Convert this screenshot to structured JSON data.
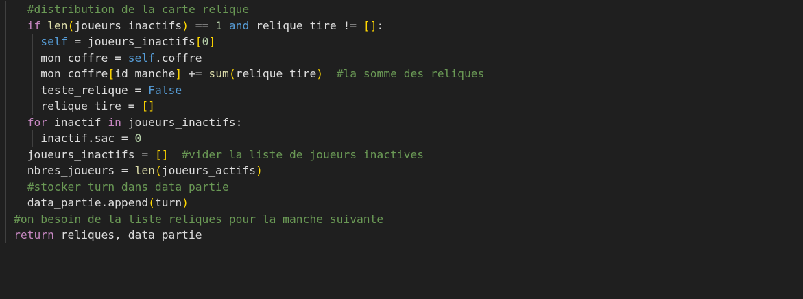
{
  "editor": {
    "language": "python",
    "theme_colors": {
      "background": "#1f1f1f",
      "keyword": "#c586c0",
      "function": "#dcdcaa",
      "comment": "#6a9955",
      "self": "#569cd6",
      "number": "#b5cea8",
      "bracket_level1": "#ffd700",
      "bracket_level2": "#da70d6",
      "bracket_level3": "#179fff"
    },
    "lines": [
      {
        "indent": 2,
        "tokens": [
          {
            "t": "#distribution de la carte relique",
            "c": "cm"
          }
        ]
      },
      {
        "indent": 2,
        "tokens": [
          {
            "t": "if",
            "c": "kw"
          },
          {
            "t": " ",
            "c": "id"
          },
          {
            "t": "len",
            "c": "fn"
          },
          {
            "t": "(",
            "c": "p1"
          },
          {
            "t": "joueurs_inactifs",
            "c": "id"
          },
          {
            "t": ")",
            "c": "p1"
          },
          {
            "t": " == ",
            "c": "op"
          },
          {
            "t": "1",
            "c": "num"
          },
          {
            "t": " ",
            "c": "id"
          },
          {
            "t": "and",
            "c": "and"
          },
          {
            "t": " relique_tire != ",
            "c": "id"
          },
          {
            "t": "[]",
            "c": "p1"
          },
          {
            "t": ":",
            "c": "id"
          }
        ]
      },
      {
        "indent": 3,
        "tokens": [
          {
            "t": "self",
            "c": "self"
          },
          {
            "t": " = joueurs_inactifs",
            "c": "id"
          },
          {
            "t": "[",
            "c": "p1"
          },
          {
            "t": "0",
            "c": "num"
          },
          {
            "t": "]",
            "c": "p1"
          }
        ]
      },
      {
        "indent": 3,
        "tokens": [
          {
            "t": "mon_coffre = ",
            "c": "id"
          },
          {
            "t": "self",
            "c": "self"
          },
          {
            "t": ".coffre",
            "c": "id"
          }
        ]
      },
      {
        "indent": 3,
        "tokens": [
          {
            "t": "mon_coffre",
            "c": "id"
          },
          {
            "t": "[",
            "c": "p1"
          },
          {
            "t": "id_manche",
            "c": "id"
          },
          {
            "t": "]",
            "c": "p1"
          },
          {
            "t": " += ",
            "c": "op"
          },
          {
            "t": "sum",
            "c": "fn"
          },
          {
            "t": "(",
            "c": "p1"
          },
          {
            "t": "relique_tire",
            "c": "id"
          },
          {
            "t": ")",
            "c": "p1"
          },
          {
            "t": "  ",
            "c": "id"
          },
          {
            "t": "#la somme des reliques",
            "c": "cm"
          }
        ]
      },
      {
        "indent": 3,
        "tokens": [
          {
            "t": "teste_relique = ",
            "c": "id"
          },
          {
            "t": "False",
            "c": "bool"
          }
        ]
      },
      {
        "indent": 3,
        "tokens": [
          {
            "t": "relique_tire = ",
            "c": "id"
          },
          {
            "t": "[]",
            "c": "p1"
          }
        ]
      },
      {
        "indent": 2,
        "tokens": [
          {
            "t": "for",
            "c": "kw"
          },
          {
            "t": " inactif ",
            "c": "id"
          },
          {
            "t": "in",
            "c": "kw"
          },
          {
            "t": " joueurs_inactifs:",
            "c": "id"
          }
        ]
      },
      {
        "indent": 3,
        "tokens": [
          {
            "t": "inactif.sac = ",
            "c": "id"
          },
          {
            "t": "0",
            "c": "num"
          }
        ]
      },
      {
        "indent": 2,
        "tokens": [
          {
            "t": "joueurs_inactifs = ",
            "c": "id"
          },
          {
            "t": "[]",
            "c": "p1"
          },
          {
            "t": "  ",
            "c": "id"
          },
          {
            "t": "#vider la liste de joueurs inactives",
            "c": "cm"
          }
        ]
      },
      {
        "indent": 2,
        "tokens": [
          {
            "t": "nbres_joueurs = ",
            "c": "id"
          },
          {
            "t": "len",
            "c": "fn"
          },
          {
            "t": "(",
            "c": "p1"
          },
          {
            "t": "joueurs_actifs",
            "c": "id"
          },
          {
            "t": ")",
            "c": "p1"
          }
        ]
      },
      {
        "indent": 2,
        "tokens": [
          {
            "t": "#stocker turn dans data_partie",
            "c": "cm"
          }
        ]
      },
      {
        "indent": 2,
        "tokens": [
          {
            "t": "data_partie.append",
            "c": "id"
          },
          {
            "t": "(",
            "c": "p1"
          },
          {
            "t": "turn",
            "c": "id"
          },
          {
            "t": ")",
            "c": "p1"
          }
        ]
      },
      {
        "indent": 1,
        "tokens": [
          {
            "t": "#on besoin de la liste reliques pour la manche suivante",
            "c": "cm"
          }
        ]
      },
      {
        "indent": 1,
        "tokens": [
          {
            "t": "return",
            "c": "kw"
          },
          {
            "t": " reliques, data_partie",
            "c": "id"
          }
        ]
      }
    ]
  }
}
